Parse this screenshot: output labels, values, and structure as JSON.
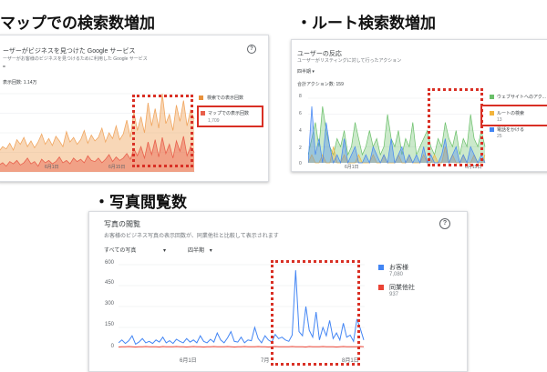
{
  "headings": {
    "maps": "マップでの検索数増加",
    "route": "・ルート検索数増加",
    "photos": "・写真閲覧数"
  },
  "card_maps": {
    "title": "ーザーがビジネスを見つけた Google サービス",
    "subtitle": "ーザーがお客様のビジネスを見つけるために利用した Google サービス",
    "dropdown": "=",
    "total_label": "表示回数: 1.14万",
    "legend": [
      {
        "label": "検索での表示回数",
        "value": "",
        "color": "#e8913b"
      },
      {
        "label": "マップでの表示回数",
        "value": "1,709",
        "color": "#e8604c"
      }
    ],
    "x_ticks": [
      "6月1日",
      "6月15日"
    ]
  },
  "card_route": {
    "title": "ユーザーの反応",
    "subtitle": "ユーザーがリスティングに対して行ったアクション",
    "period": "四半期 ▾",
    "total_label": "合計アクション数: 159",
    "y_ticks": [
      "8",
      "6",
      "4",
      "2",
      "0"
    ],
    "legend": [
      {
        "label": "ウェブサイトへのアク...",
        "value": "",
        "color": "#6abf69"
      },
      {
        "label": "ルートの検索",
        "value": "13",
        "color": "#f2b43c"
      },
      {
        "label": "電話をかける",
        "value": "25",
        "color": "#4285f4"
      }
    ],
    "x_ticks": [
      "6月1日",
      "6月15日"
    ]
  },
  "card_photos": {
    "title": "写真の閲覧",
    "subtitle": "お客様のビジネス写真の表示回数が、同業他社と比較して表示されます",
    "filter": "すべての写真",
    "period": "四半期",
    "y_ticks": [
      "600",
      "450",
      "300",
      "150",
      "0"
    ],
    "legend": [
      {
        "label": "お客様",
        "value": "7,080",
        "color": "#4285f4"
      },
      {
        "label": "同業他社",
        "value": "937",
        "color": "#ea4335"
      }
    ],
    "x_ticks": [
      "6月1日",
      "7月",
      "8月1日"
    ]
  },
  "chart_data": [
    {
      "type": "area",
      "xlabel": "",
      "ylabel": "",
      "series": [
        {
          "name": "検索での表示回数",
          "color": "#f0a660",
          "values": [
            18,
            22,
            20,
            25,
            19,
            28,
            24,
            30,
            22,
            27,
            21,
            26,
            33,
            24,
            29,
            23,
            31,
            27,
            22,
            35,
            26,
            30,
            24,
            28,
            36,
            25,
            32,
            27,
            30,
            38,
            26,
            34,
            29,
            40,
            28,
            33,
            45,
            30,
            52,
            36,
            48,
            34,
            60,
            40,
            55,
            38,
            68,
            42,
            50,
            36,
            58,
            44,
            62,
            40,
            54,
            46
          ]
        },
        {
          "name": "マップでの表示回数",
          "color": "#e8604c",
          "values": [
            6,
            8,
            5,
            9,
            7,
            10,
            6,
            8,
            12,
            7,
            9,
            5,
            11,
            8,
            10,
            7,
            9,
            13,
            8,
            10,
            7,
            12,
            9,
            11,
            8,
            14,
            10,
            9,
            12,
            8,
            11,
            15,
            9,
            13,
            10,
            12,
            16,
            11,
            20,
            14,
            22,
            12,
            26,
            15,
            28,
            13,
            30,
            16,
            24,
            12,
            27,
            18,
            31,
            14,
            22,
            17
          ]
        }
      ]
    },
    {
      "type": "area",
      "xlabel": "",
      "ylabel": "",
      "ylim": [
        0,
        8
      ],
      "series": [
        {
          "name": "ウェブサイトへのアク...",
          "color": "#6abf69",
          "values": [
            1,
            3,
            5,
            2,
            7,
            4,
            2,
            1,
            3,
            2,
            4,
            1,
            2,
            5,
            3,
            1,
            2,
            4,
            2,
            3,
            1,
            2,
            6,
            3,
            2,
            4,
            1,
            3,
            2,
            5,
            1,
            2,
            3,
            4,
            2,
            1,
            3,
            2,
            5,
            3,
            2,
            4,
            1,
            3,
            2,
            6,
            3,
            2,
            4,
            2
          ]
        },
        {
          "name": "ルートの検索",
          "color": "#f2b43c",
          "values": [
            0,
            1,
            0,
            0,
            1,
            0,
            0,
            2,
            0,
            0,
            1,
            0,
            0,
            0,
            1,
            0,
            0,
            0,
            1,
            0,
            0,
            1,
            0,
            0,
            0,
            1,
            0,
            0,
            1,
            0,
            0,
            0,
            1,
            0,
            0,
            1,
            0,
            0,
            2,
            0,
            1,
            0,
            0,
            1,
            0,
            0,
            1,
            0,
            0,
            1
          ]
        },
        {
          "name": "電話をかける",
          "color": "#4285f4",
          "values": [
            0,
            7,
            1,
            3,
            0,
            5,
            2,
            0,
            1,
            0,
            3,
            0,
            1,
            2,
            0,
            0,
            1,
            0,
            2,
            1,
            0,
            1,
            0,
            3,
            0,
            1,
            2,
            0,
            1,
            0,
            1,
            0,
            2,
            0,
            1,
            0,
            0,
            1,
            3,
            0,
            1,
            2,
            0,
            1,
            0,
            2,
            1,
            0,
            1,
            0
          ]
        }
      ]
    },
    {
      "type": "line",
      "xlabel": "",
      "ylabel": "",
      "ylim": [
        0,
        600
      ],
      "series": [
        {
          "name": "お客様",
          "color": "#4285f4",
          "values": [
            40,
            60,
            35,
            55,
            90,
            30,
            45,
            70,
            40,
            50,
            35,
            60,
            45,
            80,
            40,
            55,
            35,
            65,
            50,
            40,
            70,
            45,
            60,
            40,
            90,
            50,
            40,
            65,
            45,
            110,
            60,
            40,
            75,
            120,
            50,
            45,
            80,
            40,
            60,
            55,
            150,
            70,
            40,
            90,
            60,
            45,
            100,
            70,
            80,
            60,
            50,
            95,
            560,
            120,
            90,
            300,
            130,
            80,
            260,
            60,
            150,
            90,
            200,
            70,
            110,
            60,
            180,
            80,
            95,
            50,
            210,
            140,
            60
          ]
        },
        {
          "name": "同業他社",
          "color": "#ea4335",
          "values": [
            10,
            12,
            11,
            13,
            12,
            10,
            12,
            11,
            13,
            12,
            11,
            12,
            10,
            13,
            12,
            11,
            12,
            13,
            11,
            12,
            10,
            12,
            13,
            11,
            12,
            10,
            12,
            11,
            13,
            12,
            12,
            11,
            13,
            12,
            10,
            12,
            11,
            13,
            12,
            11,
            12,
            13,
            11,
            12,
            10,
            12,
            13,
            11,
            12,
            12,
            11,
            13,
            12,
            11,
            12,
            10,
            13,
            12,
            11,
            12,
            13,
            12,
            11,
            12,
            10,
            12,
            13,
            11,
            12,
            11,
            12,
            13,
            12
          ]
        }
      ]
    }
  ]
}
